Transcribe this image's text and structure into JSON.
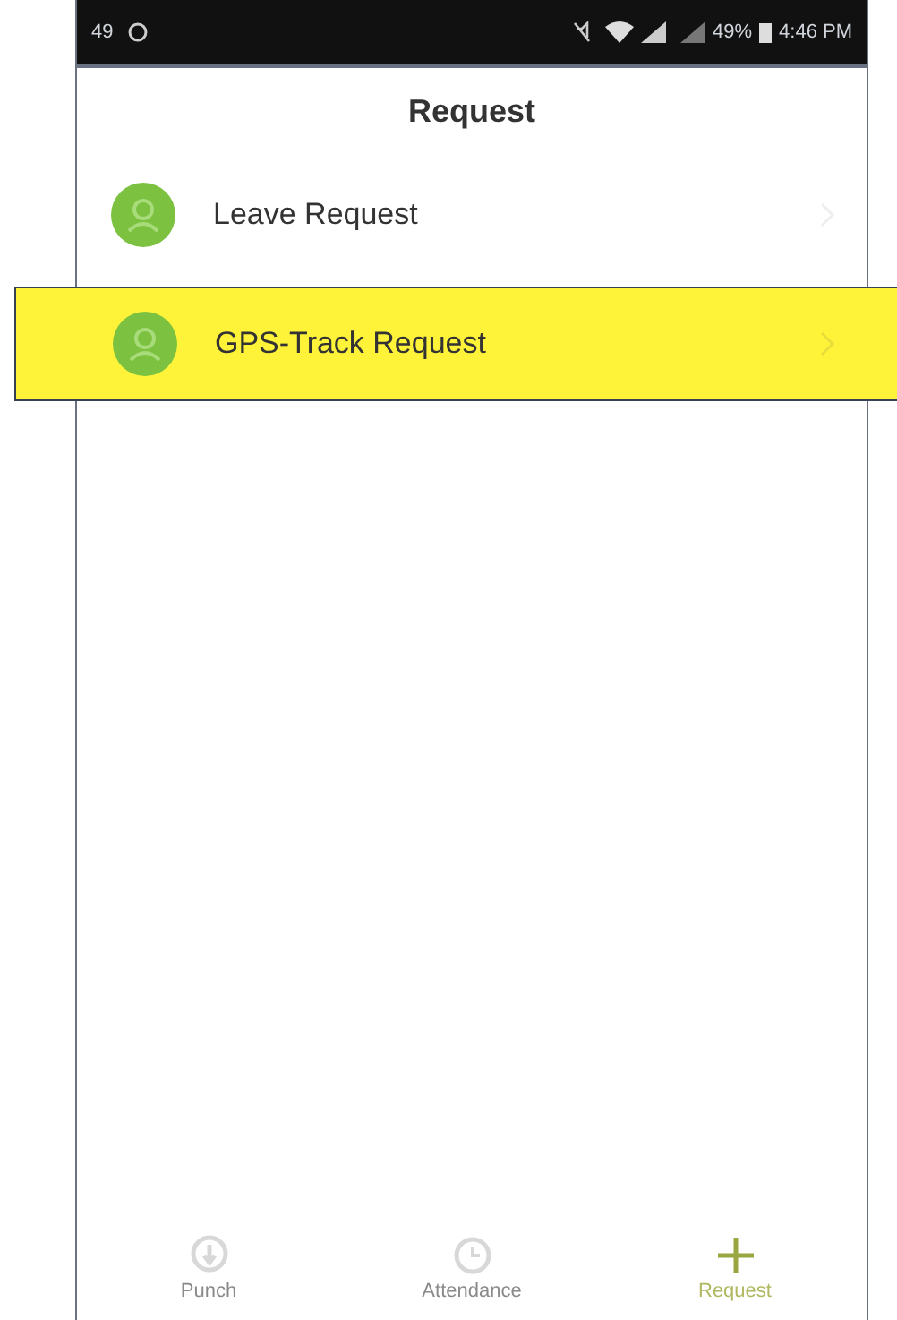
{
  "status_bar": {
    "left_text": "49",
    "battery": "49%",
    "time": "4:46 PM"
  },
  "title": "Request",
  "items": [
    {
      "label": "Leave Request",
      "highlighted": false
    },
    {
      "label": "GPS-Track Request",
      "highlighted": true
    }
  ],
  "tabs": [
    {
      "label": "Punch",
      "kind": "punch",
      "selected": false
    },
    {
      "label": "Attendance",
      "kind": "attendance",
      "selected": false
    },
    {
      "label": "Request",
      "kind": "request",
      "selected": true
    }
  ]
}
